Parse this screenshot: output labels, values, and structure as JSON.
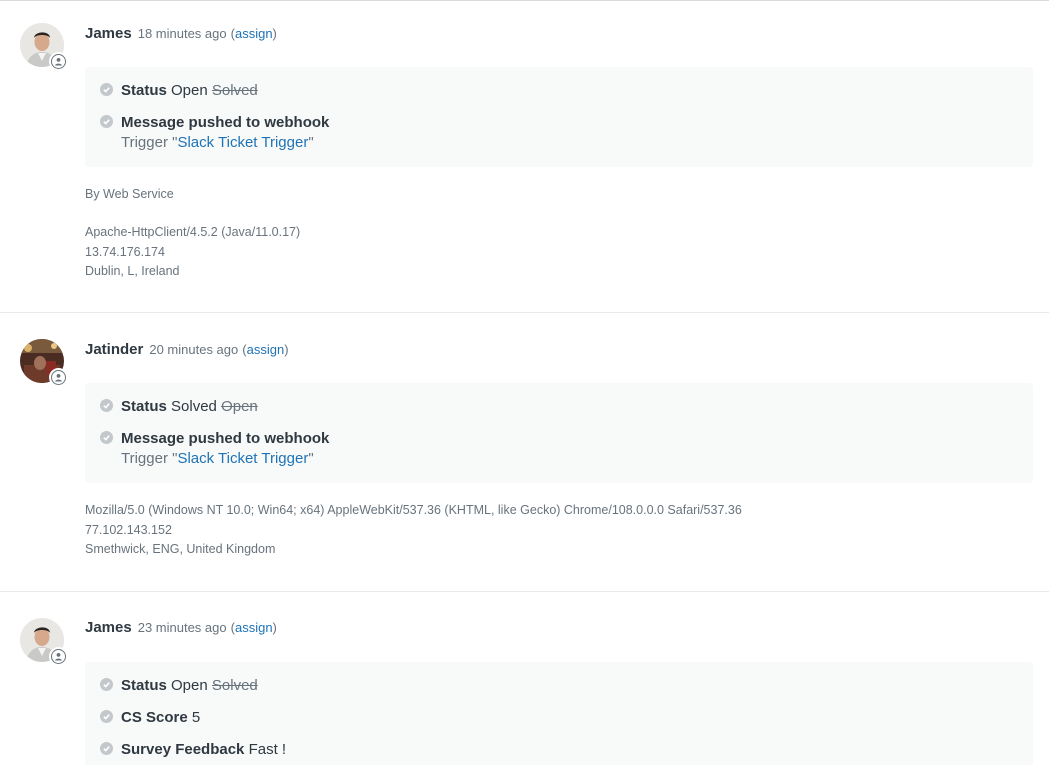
{
  "events": [
    {
      "author": "James",
      "time": "18 minutes ago",
      "assign_link": "assign",
      "changes": {
        "status": {
          "label": "Status",
          "new": "Open",
          "old": "Solved"
        },
        "webhook": {
          "label": "Message pushed to webhook",
          "trigger_prefix": "Trigger \"",
          "trigger_name": "Slack Ticket Trigger",
          "trigger_suffix": "\""
        }
      },
      "via": "By Web Service",
      "user_agent": "Apache-HttpClient/4.5.2 (Java/11.0.17)",
      "ip": "13.74.176.174",
      "location": "Dublin, L, Ireland"
    },
    {
      "author": "Jatinder",
      "time": "20 minutes ago",
      "assign_link": "assign",
      "changes": {
        "status": {
          "label": "Status",
          "new": "Solved",
          "old": "Open"
        },
        "webhook": {
          "label": "Message pushed to webhook",
          "trigger_prefix": "Trigger \"",
          "trigger_name": "Slack Ticket Trigger",
          "trigger_suffix": "\""
        }
      },
      "user_agent": "Mozilla/5.0 (Windows NT 10.0; Win64; x64) AppleWebKit/537.36 (KHTML, like Gecko) Chrome/108.0.0.0 Safari/537.36",
      "ip": "77.102.143.152",
      "location": "Smethwick, ENG, United Kingdom"
    },
    {
      "author": "James",
      "time": "23 minutes ago",
      "assign_link": "assign",
      "changes": {
        "status": {
          "label": "Status",
          "new": "Open",
          "old": "Solved"
        },
        "cs_score": {
          "label": "CS Score",
          "value": "5"
        },
        "survey": {
          "label": "Survey Feedback",
          "value": "Fast !"
        }
      }
    }
  ],
  "icons": {
    "check": "check-circle-icon",
    "agent": "agent-person-icon"
  },
  "colors": {
    "link": "#1f73b7",
    "muted": "#68737d",
    "panel": "#f8f9f9",
    "check": "#c2c8cc"
  }
}
